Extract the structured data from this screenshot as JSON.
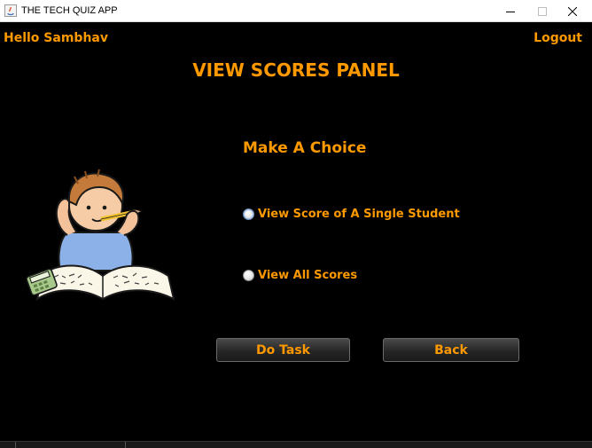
{
  "window": {
    "title": "THE TECH QUIZ APP",
    "controls": [
      "minimize-icon",
      "maximize-icon",
      "close-icon"
    ]
  },
  "header": {
    "greeting": "Hello Sambhav",
    "logout_label": "Logout"
  },
  "panel": {
    "title": "VIEW SCORES PANEL",
    "prompt": "Make A Choice"
  },
  "options": [
    {
      "label": "View Score of A Single Student",
      "selected": true
    },
    {
      "label": "View All Scores",
      "selected": false
    }
  ],
  "buttons": {
    "do_task": "Do Task",
    "back": "Back"
  },
  "colors": {
    "accent": "#ff9900",
    "background": "#000000"
  }
}
